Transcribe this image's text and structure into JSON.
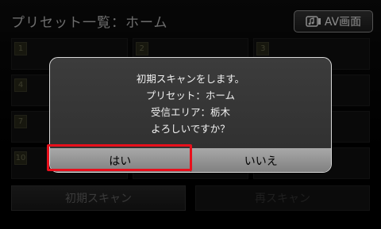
{
  "header": {
    "title": "プリセット一覧：ホーム",
    "av_button_label": "AV画面"
  },
  "grid": {
    "numbers": [
      "1",
      "2",
      "3",
      "4",
      "",
      "",
      "7",
      "",
      "",
      "10",
      "",
      ""
    ]
  },
  "bottom": {
    "initial_scan_label": "初期スキャン",
    "rescan_label": "再スキャン"
  },
  "dialog": {
    "lines": [
      "初期スキャンをします。",
      "プリセット：ホーム",
      "受信エリア：栃木",
      "よろしいですか？"
    ],
    "yes_label": "はい",
    "no_label": "いいえ"
  },
  "colors": {
    "highlight": "#e8101c"
  }
}
